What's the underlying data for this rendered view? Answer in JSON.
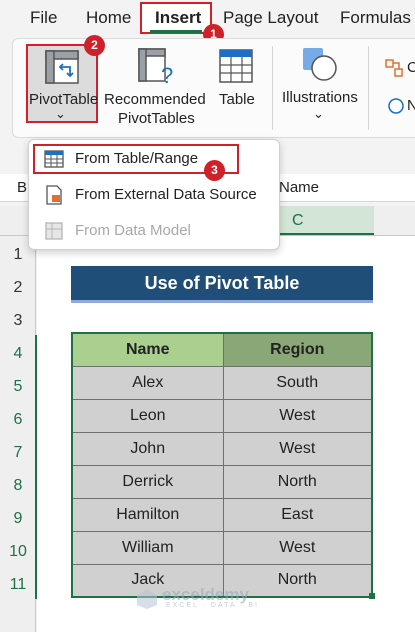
{
  "ribbon_tabs": [
    {
      "label": "File"
    },
    {
      "label": "Home"
    },
    {
      "label": "Insert"
    },
    {
      "label": "Page Layout"
    },
    {
      "label": "Formulas"
    }
  ],
  "ribbon": {
    "pivottable_label": "PivotTable",
    "pivottable_chevron": "⌄",
    "recommended_line1": "Recommended",
    "recommended_line2": "PivotTables",
    "table_label": "Table",
    "illustrations_label": "Illustrations",
    "illustrations_chevron": "⌄",
    "edge_text_1": "C",
    "edge_text_2": "N"
  },
  "badges": {
    "insert_step": "1",
    "pivot_step": "2",
    "range_step": "3"
  },
  "dropdown": {
    "items": [
      {
        "label": "From Table/Range",
        "icon": "table-range-icon",
        "disabled": false
      },
      {
        "label": "From External Data Source",
        "icon": "external-data-icon",
        "disabled": false
      },
      {
        "label": "From Data Model",
        "icon": "data-model-icon",
        "disabled": true
      }
    ]
  },
  "sheet": {
    "namebox_partial": "B",
    "formula_partial": "Name",
    "col_c": "C",
    "row_numbers": [
      "1",
      "2",
      "3",
      "4",
      "5",
      "6",
      "7",
      "8",
      "9",
      "10",
      "11"
    ],
    "title": "Use of Pivot Table",
    "headers": [
      "Name",
      "Region"
    ],
    "rows": [
      [
        "Alex",
        "South"
      ],
      [
        "Leon",
        "West"
      ],
      [
        "John",
        "West"
      ],
      [
        "Derrick",
        "North"
      ],
      [
        "Hamilton",
        "East"
      ],
      [
        "William",
        "West"
      ],
      [
        "Jack",
        "North"
      ]
    ]
  },
  "watermark": {
    "brand": "exceldemy",
    "tagline": "EXCEL · DATA · BI"
  },
  "colors": {
    "accent_red": "#d0202a",
    "excel_green": "#1e7145",
    "title_blue": "#1f4e79",
    "header_green": "#a9d08e",
    "header_green_dark": "#8aa877",
    "cell_gray": "#d0d0d0"
  }
}
